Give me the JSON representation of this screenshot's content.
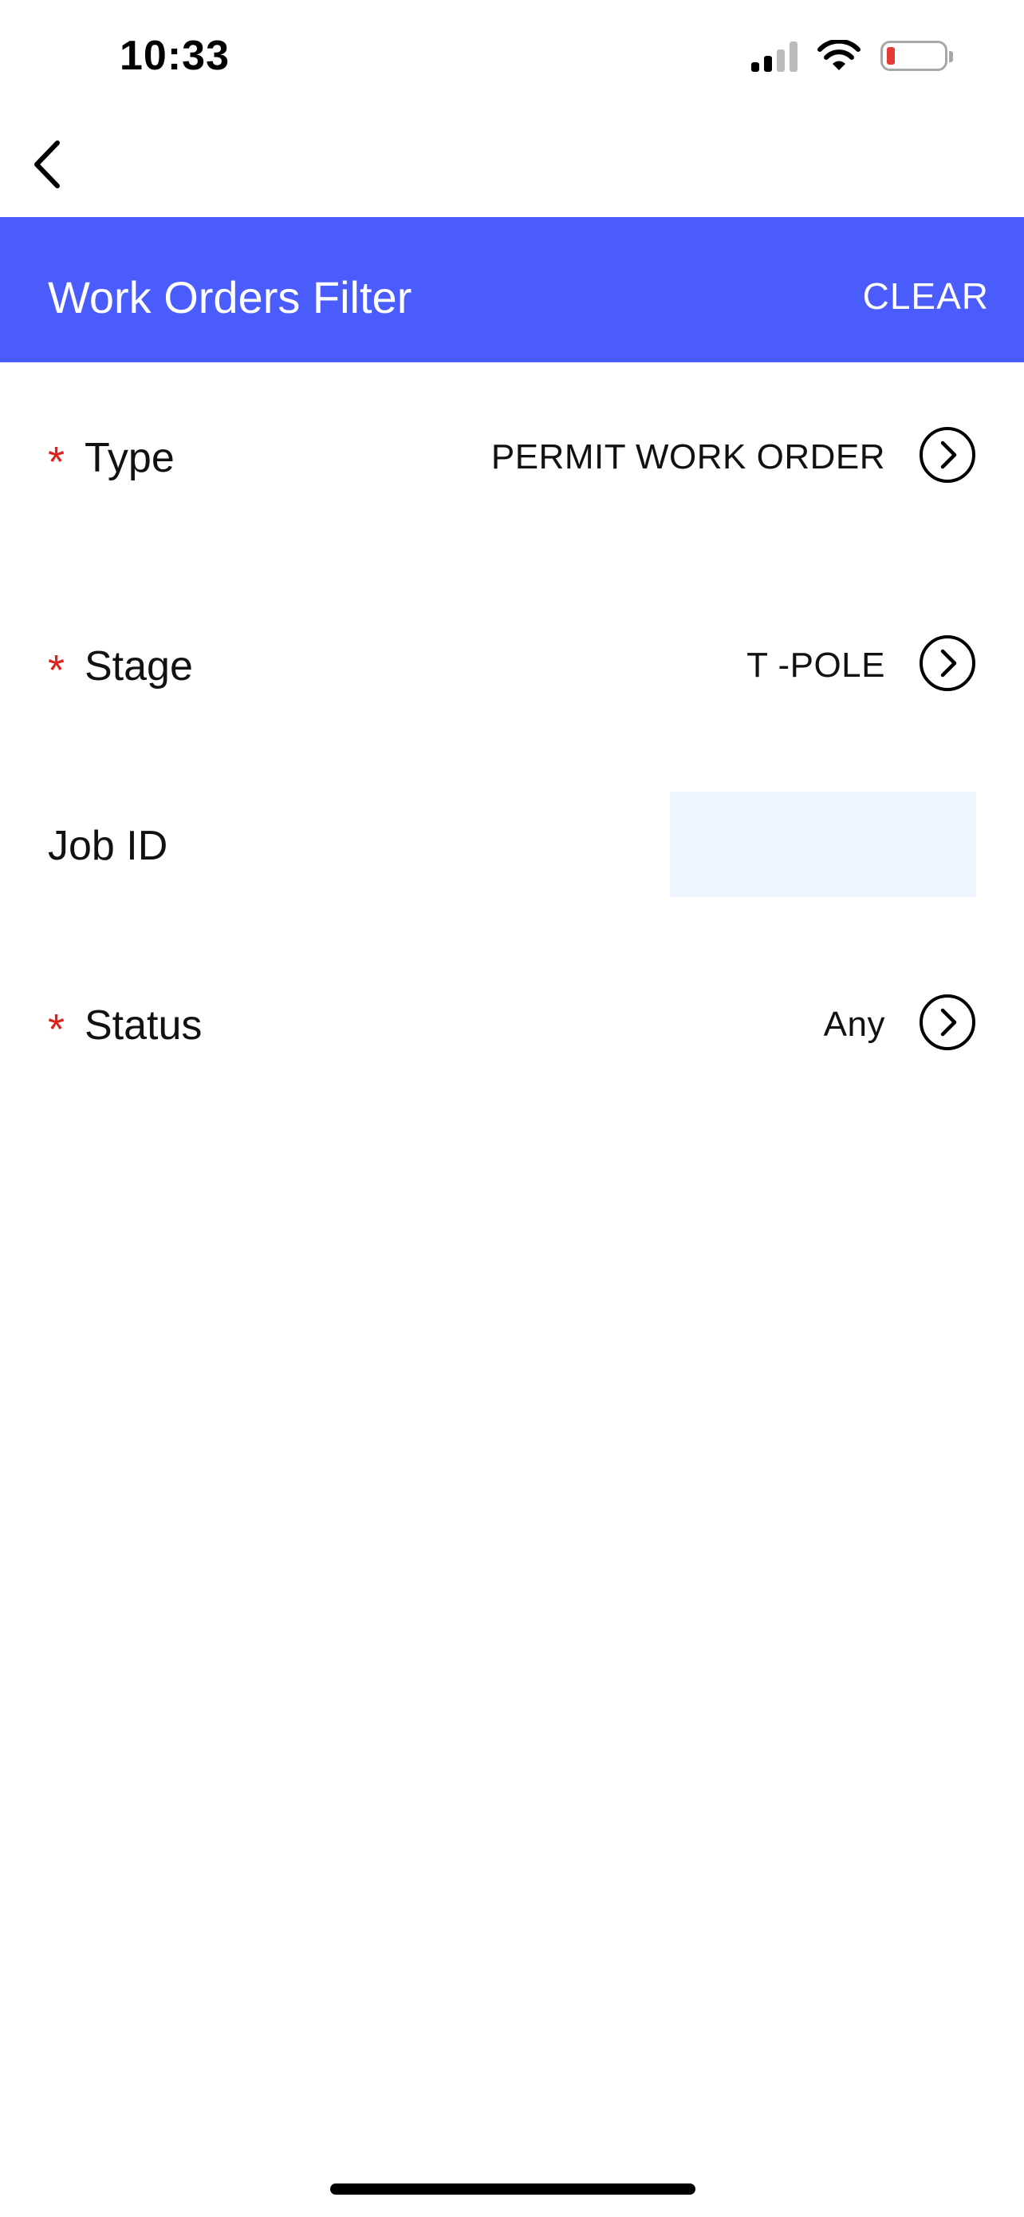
{
  "status_bar": {
    "time": "10:33",
    "icons": [
      "cellular-signal-icon",
      "wifi-icon",
      "battery-low-icon"
    ],
    "battery_color": "#e53935"
  },
  "nav": {
    "back_icon": "chevron-left-icon"
  },
  "header": {
    "title": "Work Orders Filter",
    "clear_label": "CLEAR",
    "background_color": "#4a5cfb"
  },
  "filters": {
    "type": {
      "required_marker": "*",
      "label": "Type",
      "value": "PERMIT WORK ORDER",
      "icon": "chevron-right-circle-icon"
    },
    "stage": {
      "required_marker": "*",
      "label": "Stage",
      "value": "T -POLE",
      "icon": "chevron-right-circle-icon"
    },
    "job_id": {
      "label": "Job ID",
      "value": ""
    },
    "status": {
      "required_marker": "*",
      "label": "Status",
      "value": "Any",
      "icon": "chevron-right-circle-icon"
    }
  },
  "colors": {
    "required": "#e0201c",
    "input_background": "#eef5ff"
  }
}
